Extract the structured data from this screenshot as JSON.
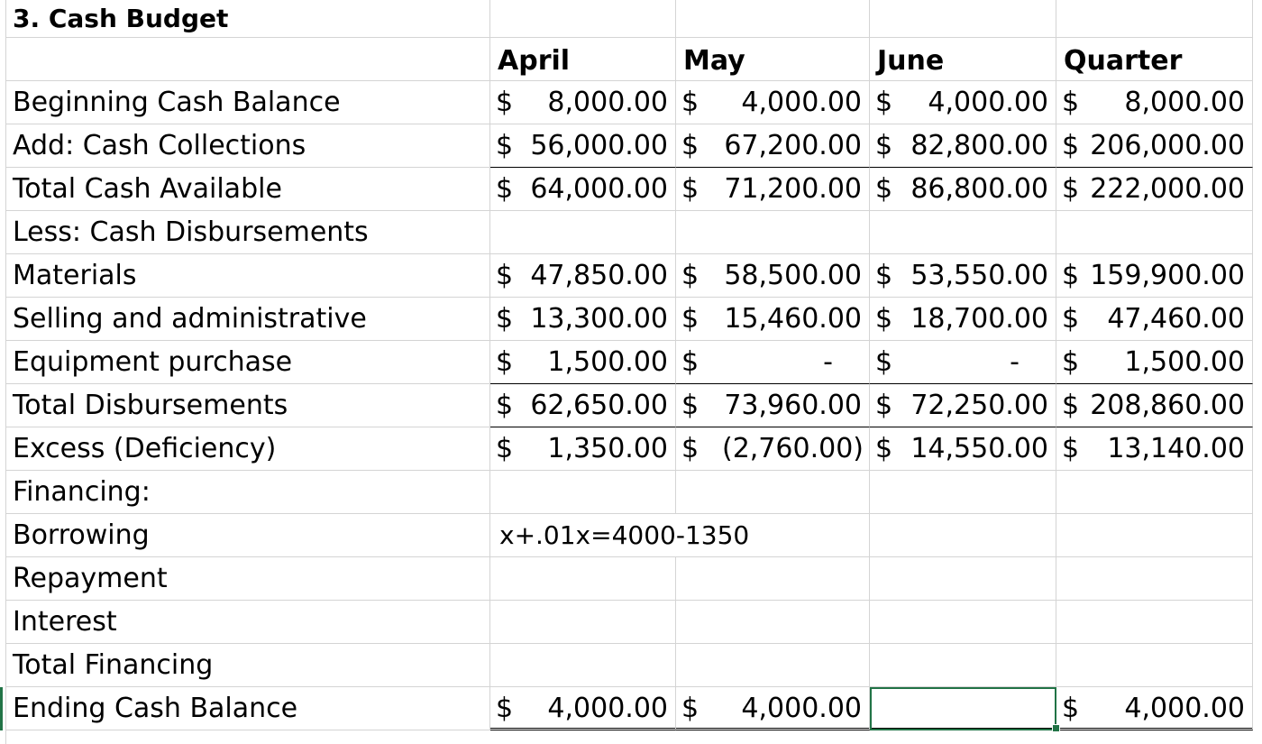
{
  "sheet": {
    "title": "3. Cash Budget",
    "headers": [
      "April",
      "May",
      "June",
      "Quarter"
    ],
    "rows": [
      {
        "label": "Beginning Cash Balance",
        "april": "8,000.00",
        "may": "4,000.00",
        "june": "4,000.00",
        "quarter": "8,000.00"
      },
      {
        "label": "Add: Cash Collections",
        "april": "56,000.00",
        "may": "67,200.00",
        "june": "82,800.00",
        "quarter": "206,000.00"
      },
      {
        "label": "Total Cash Available",
        "april": "64,000.00",
        "may": "71,200.00",
        "june": "86,800.00",
        "quarter": "222,000.00"
      },
      {
        "label": "Less: Cash Disbursements"
      },
      {
        "label": "Materials",
        "april": "47,850.00",
        "may": "58,500.00",
        "june": "53,550.00",
        "quarter": "159,900.00"
      },
      {
        "label": "Selling and administrative",
        "april": "13,300.00",
        "may": "15,460.00",
        "june": "18,700.00",
        "quarter": "47,460.00"
      },
      {
        "label": "Equipment purchase",
        "april": "1,500.00",
        "may": "-",
        "june": "-",
        "quarter": "1,500.00"
      },
      {
        "label": "Total Disbursements",
        "april": "62,650.00",
        "may": "73,960.00",
        "june": "72,250.00",
        "quarter": "208,860.00"
      },
      {
        "label": "Excess (Deficiency)",
        "april": "1,350.00",
        "may": "(2,760.00)",
        "june": "14,550.00",
        "quarter": "13,140.00"
      },
      {
        "label": "Financing:"
      },
      {
        "label": "Borrowing",
        "note": "x+.01x=4000-1350"
      },
      {
        "label": "Repayment"
      },
      {
        "label": "Interest"
      },
      {
        "label": "Total Financing"
      },
      {
        "label": "Ending Cash Balance",
        "april": "4,000.00",
        "may": "4,000.00",
        "june": "",
        "quarter": "4,000.00"
      }
    ],
    "currency_symbol": "$"
  },
  "colors": {
    "gridline": "#d4d4d4",
    "selection": "#217346"
  }
}
